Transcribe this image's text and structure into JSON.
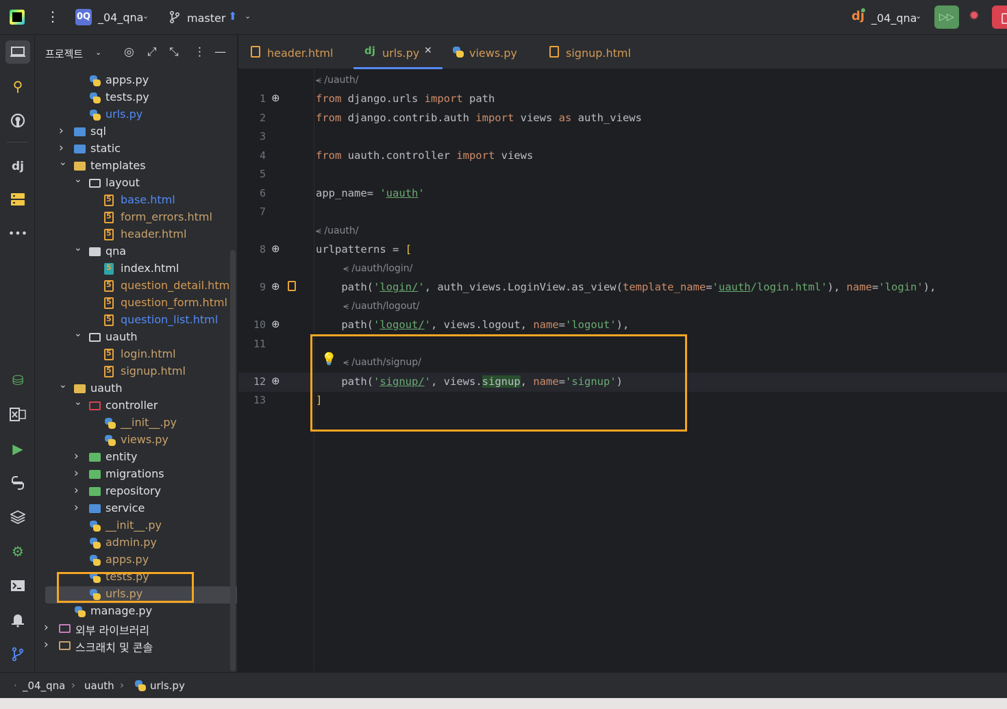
{
  "topbar": {
    "project_badge": "0Q",
    "project_name": "_04_qna",
    "branch": "master",
    "run_config": "_04_qna",
    "dj_logo": "dj"
  },
  "tools": [
    "project-icon",
    "commit-icon",
    "github-icon",
    "django-structure-icon",
    "services-icon",
    "more-icon",
    "database-icon",
    "excel-icon",
    "run-icon",
    "python-console-icon",
    "layers-icon",
    "settings-icon",
    "terminal-icon",
    "notifications-icon",
    "git-icon"
  ],
  "project_panel": {
    "title": "프로젝트",
    "tree": [
      {
        "label": "apps.py",
        "indent": 2,
        "icon": "python",
        "color": "default"
      },
      {
        "label": "tests.py",
        "indent": 2,
        "icon": "python",
        "color": "default"
      },
      {
        "label": "urls.py",
        "indent": 2,
        "icon": "python",
        "color": "blue"
      },
      {
        "label": "sql",
        "indent": 1,
        "icon": "folder-blue",
        "color": "default",
        "arrow": ">"
      },
      {
        "label": "static",
        "indent": 1,
        "icon": "folder-blue",
        "color": "default",
        "arrow": ">"
      },
      {
        "label": "templates",
        "indent": 1,
        "icon": "folder-yellow",
        "color": "default",
        "arrow": "v"
      },
      {
        "label": "layout",
        "indent": 2,
        "icon": "folder-plain",
        "color": "default",
        "arrow": "v"
      },
      {
        "label": "base.html",
        "indent": 3,
        "icon": "html",
        "color": "blue"
      },
      {
        "label": "form_errors.html",
        "indent": 3,
        "icon": "html",
        "color": "olive"
      },
      {
        "label": "header.html",
        "indent": 3,
        "icon": "html",
        "color": "olive"
      },
      {
        "label": "qna",
        "indent": 2,
        "icon": "folder-filled",
        "color": "default",
        "arrow": "v"
      },
      {
        "label": "index.html",
        "indent": 3,
        "icon": "html-index",
        "color": "default"
      },
      {
        "label": "question_detail.html",
        "indent": 3,
        "icon": "html",
        "color": "orange"
      },
      {
        "label": "question_form.html",
        "indent": 3,
        "icon": "html",
        "color": "orange"
      },
      {
        "label": "question_list.html",
        "indent": 3,
        "icon": "html",
        "color": "blue"
      },
      {
        "label": "uauth",
        "indent": 2,
        "icon": "folder-plain",
        "color": "default",
        "arrow": "v"
      },
      {
        "label": "login.html",
        "indent": 3,
        "icon": "html",
        "color": "olive"
      },
      {
        "label": "signup.html",
        "indent": 3,
        "icon": "html",
        "color": "olive"
      },
      {
        "label": "uauth",
        "indent": 1,
        "icon": "folder-yellow",
        "color": "default",
        "arrow": "v"
      },
      {
        "label": "controller",
        "indent": 2,
        "icon": "folder-red",
        "color": "default",
        "arrow": "v"
      },
      {
        "label": "__init__.py",
        "indent": 3,
        "icon": "python",
        "color": "olive"
      },
      {
        "label": "views.py",
        "indent": 3,
        "icon": "python",
        "color": "olive"
      },
      {
        "label": "entity",
        "indent": 2,
        "icon": "folder-green",
        "color": "default",
        "arrow": ">"
      },
      {
        "label": "migrations",
        "indent": 2,
        "icon": "folder-green",
        "color": "default",
        "arrow": ">"
      },
      {
        "label": "repository",
        "indent": 2,
        "icon": "folder-green",
        "color": "default",
        "arrow": ">"
      },
      {
        "label": "service",
        "indent": 2,
        "icon": "folder-blue",
        "color": "default",
        "arrow": ">"
      },
      {
        "label": "__init__.py",
        "indent": 2,
        "icon": "python",
        "color": "olive"
      },
      {
        "label": "admin.py",
        "indent": 2,
        "icon": "python",
        "color": "olive"
      },
      {
        "label": "apps.py",
        "indent": 2,
        "icon": "python",
        "color": "olive"
      },
      {
        "label": "tests.py",
        "indent": 2,
        "icon": "python",
        "color": "olive"
      },
      {
        "label": "urls.py",
        "indent": 2,
        "icon": "python",
        "color": "olive",
        "selected": true
      },
      {
        "label": "manage.py",
        "indent": 1,
        "icon": "python",
        "color": "default"
      },
      {
        "label": "외부 라이브러리",
        "indent": 0,
        "icon": "library",
        "color": "default",
        "arrow": ">"
      },
      {
        "label": "스크래치 및 콘솔",
        "indent": 0,
        "icon": "scratch",
        "color": "default",
        "arrow": ">"
      }
    ]
  },
  "tabs": [
    {
      "label": "header.html",
      "icon": "html",
      "color": "#d49a54"
    },
    {
      "label": "urls.py",
      "icon": "django",
      "color": "#d49a54",
      "active": true,
      "closable": true
    },
    {
      "label": "views.py",
      "icon": "python",
      "color": "#d49a54"
    },
    {
      "label": "signup.html",
      "icon": "html",
      "color": "#d49a54"
    }
  ],
  "editor": {
    "hints": [
      "/uauth/",
      "/uauth/",
      "/uauth/login/",
      "/uauth/logout/",
      "/uauth/signup/"
    ],
    "lines": [
      {
        "no": "1",
        "text": "from django.urls import path"
      },
      {
        "no": "2",
        "text": "from django.contrib.auth import views as auth_views"
      },
      {
        "no": "3",
        "text": ""
      },
      {
        "no": "4",
        "text": "from uauth.controller import views"
      },
      {
        "no": "5",
        "text": ""
      },
      {
        "no": "6",
        "text": "app_name= 'uauth'"
      },
      {
        "no": "7",
        "text": ""
      },
      {
        "no": "8",
        "text": "urlpatterns = ["
      },
      {
        "no": "9",
        "text": "    path('login/', auth_views.LoginView.as_view(template_name='uauth/login.html'), name='login'),"
      },
      {
        "no": "10",
        "text": "    path('logout/', views.logout, name='logout'),"
      },
      {
        "no": "11",
        "text": ""
      },
      {
        "no": "12",
        "text": "    path('signup/', views.signup, name='signup')"
      },
      {
        "no": "13",
        "text": "]"
      }
    ]
  },
  "statusbar": {
    "crumbs": [
      "_04_qna",
      "uauth",
      "urls.py"
    ]
  },
  "colors": {
    "highlight_box": "#f5a623",
    "accent": "#548af7",
    "run_green": "#57965c",
    "stop_red": "#d9424f"
  }
}
